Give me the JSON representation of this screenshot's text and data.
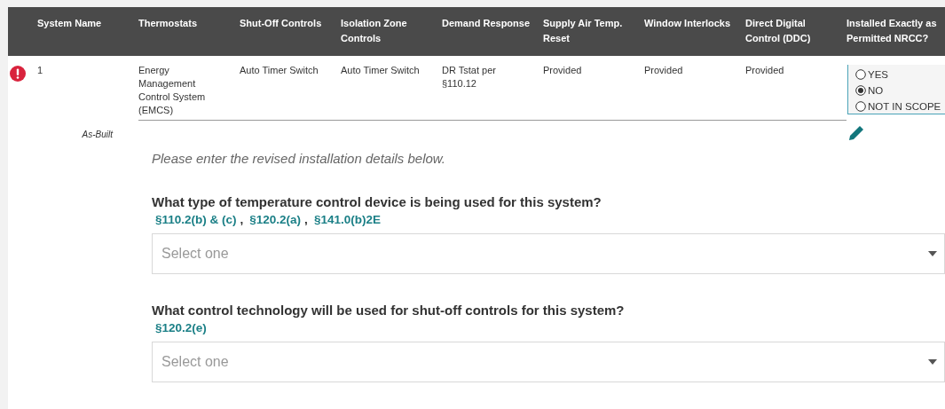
{
  "table": {
    "columns": [
      "System Name",
      "Thermostats",
      "Shut-Off Controls",
      "Isolation Zone Controls",
      "Demand Response",
      "Supply Air Temp. Reset",
      "Window Interlocks",
      "Direct Digital Control (DDC)",
      "Installed Exactly as Permitted NRCC?"
    ],
    "rows": [
      {
        "flagged": true,
        "cells": [
          "1",
          "Energy Management Control System (EMCS)",
          "Auto Timer Switch",
          "Auto Timer Switch",
          "DR Tstat per §110.12",
          "Provided",
          "Provided",
          "Provided"
        ],
        "options": [
          {
            "label": "YES",
            "selected": false
          },
          {
            "label": "NO",
            "selected": true
          },
          {
            "label": "NOT IN SCOPE",
            "selected": false
          }
        ],
        "row_label": "As-Built"
      }
    ]
  },
  "form": {
    "instruction": "Please enter the revised installation details below.",
    "questions": [
      {
        "question": "What type of temperature control device is being used for this system?",
        "refs": [
          {
            "kind": "link",
            "text": "§110.2(b) & (c)"
          },
          {
            "kind": "sep",
            "text": ","
          },
          {
            "kind": "link",
            "text": "§120.2(a)"
          },
          {
            "kind": "sep",
            "text": ","
          },
          {
            "kind": "link",
            "text": "§141.0(b)2E"
          }
        ],
        "placeholder": "Select one"
      },
      {
        "question": "What control technology will be used for shut-off controls for this system?",
        "refs": [
          {
            "kind": "link",
            "text": "§120.2(e)"
          }
        ],
        "placeholder": "Select one"
      }
    ]
  }
}
